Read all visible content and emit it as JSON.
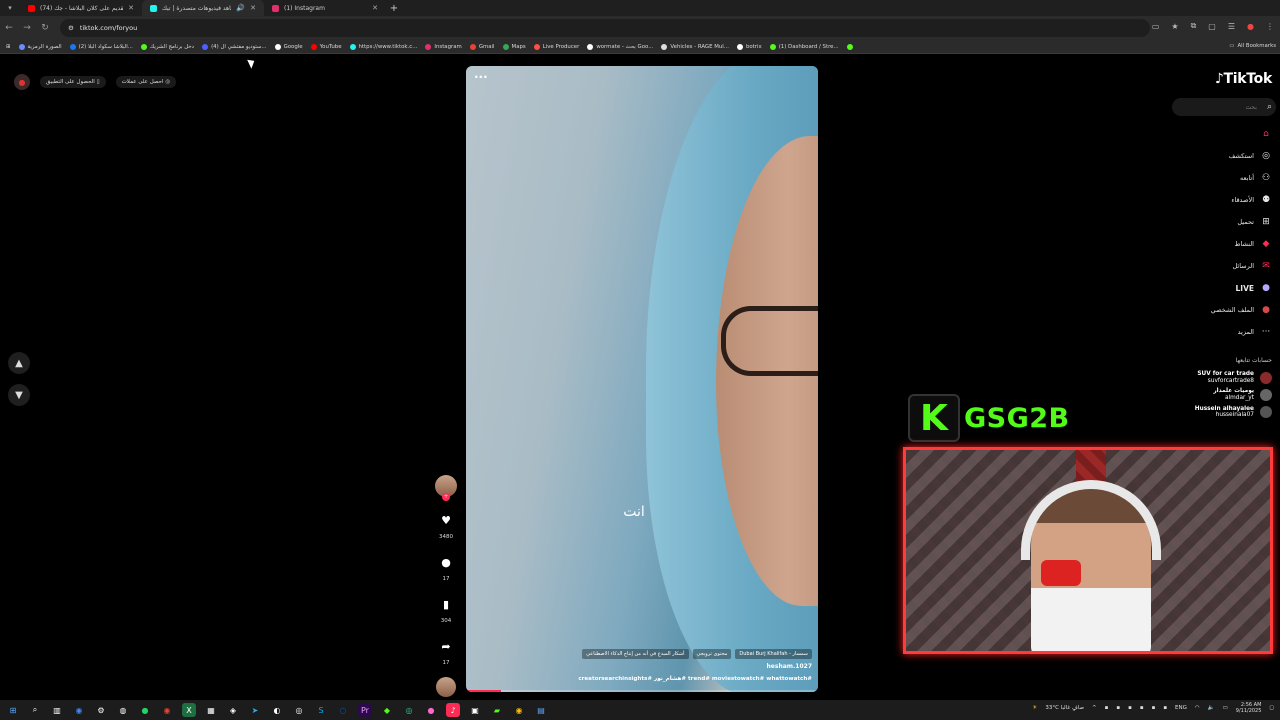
{
  "browser": {
    "tabs": [
      {
        "title": "(74) تقديم على كلان البلاشا - جك",
        "color": "#ff0000",
        "active": false
      },
      {
        "title": "شاهد فيديوهات متصدرة | تيك",
        "color": "#25f4ee",
        "active": true
      },
      {
        "title": "(1) Instagram",
        "color": "#e1306c",
        "active": false
      }
    ],
    "new_tab": "+",
    "url": "tiktok.com/foryou",
    "bookmarks": [
      {
        "label": "الصورة الرمزية",
        "color": "#6b8cff"
      },
      {
        "label": "(2) البلاشا سكواد البلا...",
        "color": "#1877f2"
      },
      {
        "label": "دخل برنامج الشريك",
        "color": "#53fc18"
      },
      {
        "label": "(4) ستوديو مفتشي ال...",
        "color": "#4e5fff"
      },
      {
        "label": "Google",
        "color": "#ffffff"
      },
      {
        "label": "YouTube",
        "color": "#ff0000"
      },
      {
        "label": "https://www.tiktok.c...",
        "color": "#25f4ee"
      },
      {
        "label": "Instagram",
        "color": "#e1306c"
      },
      {
        "label": "Gmail",
        "color": "#ea4335"
      },
      {
        "label": "Maps",
        "color": "#34a853"
      },
      {
        "label": "Live Producer",
        "color": "#ff4e45"
      },
      {
        "label": "wormate - بحث Goo...",
        "color": "#ffffff"
      },
      {
        "label": "Vehicles - RAGE Mul...",
        "color": "#dddddd"
      },
      {
        "label": "botrix",
        "color": "#ffffff"
      },
      {
        "label": "(1) Dashboard / Stre...",
        "color": "#53fc18"
      }
    ],
    "all_bookmarks": "All Bookmarks"
  },
  "tiktok": {
    "top_left": {
      "get_coins": "احصل على عملات",
      "get_app": "الحصول على التطبيق"
    },
    "logo": "TikTok",
    "search_placeholder": "بحث",
    "menu": [
      {
        "label": "",
        "icon": "home-icon",
        "color": "#fe2c55"
      },
      {
        "label": "استكشف",
        "icon": "compass-icon"
      },
      {
        "label": "أتابعه",
        "icon": "following-icon"
      },
      {
        "label": "الأصدقاء",
        "icon": "friends-icon"
      },
      {
        "label": "تحميل",
        "icon": "upload-icon"
      },
      {
        "label": "النشاط",
        "icon": "activity-icon"
      },
      {
        "label": "الرسائل",
        "icon": "messages-icon"
      },
      {
        "label": "LIVE",
        "icon": "live-icon"
      },
      {
        "label": "الملف الشخصي",
        "icon": "profile-icon"
      },
      {
        "label": "المزيد",
        "icon": "more-icon"
      }
    ],
    "following_title": "حسابات تتابعها",
    "following": [
      {
        "name": "SUV for car trade",
        "handle": "suvforcartrade8"
      },
      {
        "name": "يوميات علمدار",
        "handle": "almdar_yt"
      },
      {
        "name": "Hussein alhayalee",
        "handle": "husseinala07"
      }
    ],
    "video": {
      "subtitle": "انت",
      "tags": [
        "أشكار المبدع في أنه من إنتاج الذكاء الاصطناعي",
        "محتوى ترويجي",
        "Dubai Burj Khalifah - سمسار"
      ],
      "author": "hesham.1027",
      "hashtags": "creatorsearchinsights# هشام_نور# trend# moviestowatch# whattowatch#",
      "progress": 0.1
    },
    "actions": {
      "likes": "3480",
      "comments": "17",
      "saves": "304",
      "shares": "17"
    }
  },
  "overlay": {
    "k_logo": "K",
    "brand": "GSG2B"
  },
  "taskbar": {
    "weather": "33°C صافٍ غالبا",
    "lang": "ENG",
    "time": "2:56 AM",
    "date": "9/11/2025"
  }
}
